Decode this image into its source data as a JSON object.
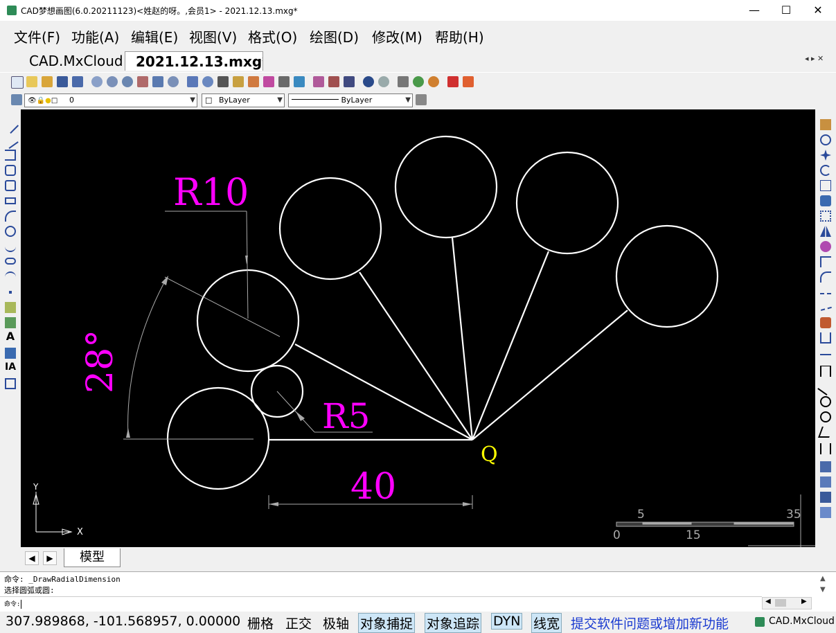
{
  "window": {
    "title": "CAD梦想画图(6.0.20211123)<姓赵的呀。,会员1> - 2021.12.13.mxg*",
    "minimize_glyph": "—",
    "maximize_glyph": "☐",
    "close_glyph": "✕"
  },
  "menu": [
    {
      "label": "文件(F)"
    },
    {
      "label": "功能(A)"
    },
    {
      "label": "编辑(E)"
    },
    {
      "label": "视图(V)"
    },
    {
      "label": "格式(O)"
    },
    {
      "label": "绘图(D)"
    },
    {
      "label": "修改(M)"
    },
    {
      "label": "帮助(H)"
    }
  ],
  "tabs": {
    "inactive": "CAD.MxCloud",
    "active": "2021.12.13.mxg*",
    "nav": "◂ ▸ ✕"
  },
  "toolbar2": {
    "layer_value": "0",
    "color_value": "ByLayer",
    "linetype_value": "ByLayer"
  },
  "drawing": {
    "labels": {
      "r10": "R10",
      "r5": "R5",
      "angle": "28°",
      "dist": "40",
      "point": "Q"
    },
    "axis": {
      "x": "X",
      "y": "Y"
    },
    "scale": {
      "top_left": "5",
      "top_right": "35",
      "bottom_left": "0",
      "bottom_mid": "15"
    },
    "colors": {
      "dimension_text": "#ff00ff",
      "point_label": "#ffff00",
      "geometry": "#ffffff",
      "dimension_line": "#aaaaaa"
    }
  },
  "layout": {
    "tab_model": "模型"
  },
  "command": {
    "line1": "命令: _DrawRadialDimension",
    "line2": " 选择圆弧或圆:",
    "line3": "命令: "
  },
  "status": {
    "coords": "307.989868,  -101.568957,  0.00000",
    "grid": "栅格",
    "ortho": "正交",
    "polar": "极轴",
    "osnap": "对象捕捉",
    "otrack": "对象追踪",
    "dyn": "DYN",
    "lwt": "线宽",
    "feedback": "提交软件问题或增加新功能",
    "brand": "CAD.MxCloud"
  }
}
